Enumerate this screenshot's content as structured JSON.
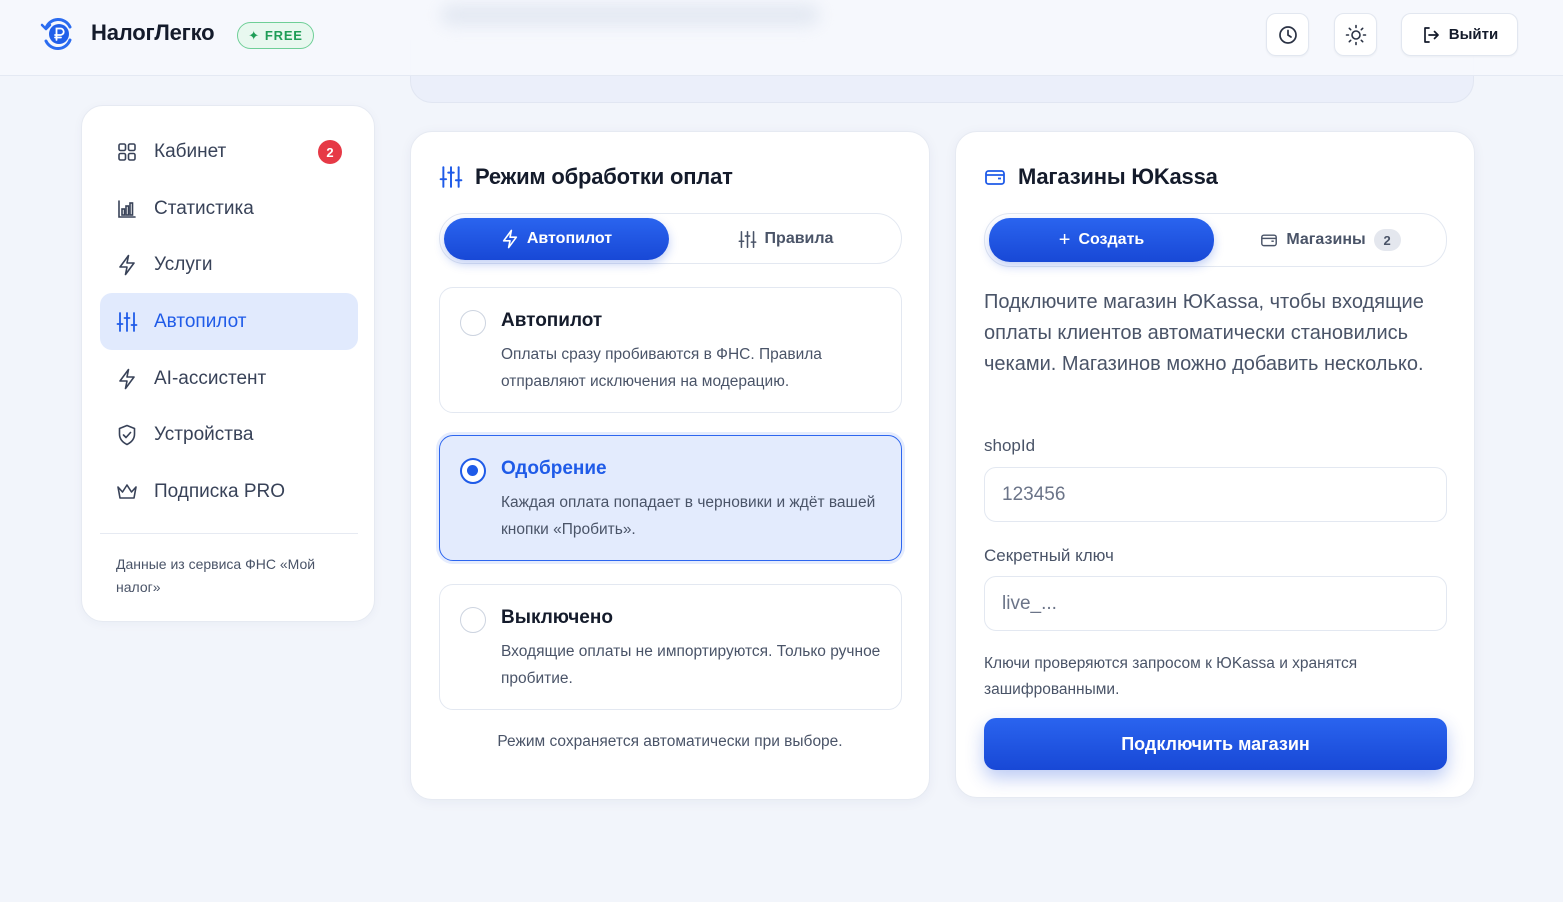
{
  "header": {
    "brand": "НалогЛегко",
    "plan_badge": "FREE",
    "logout_label": "Выйти"
  },
  "sidebar": {
    "items": [
      {
        "label": "Кабинет",
        "icon": "grid-icon",
        "badge": "2"
      },
      {
        "label": "Статистика",
        "icon": "bar-chart-icon"
      },
      {
        "label": "Услуги",
        "icon": "lightning-icon"
      },
      {
        "label": "Автопилот",
        "icon": "sliders-icon",
        "active": true
      },
      {
        "label": "AI-ассистент",
        "icon": "lightning-icon"
      },
      {
        "label": "Устройства",
        "icon": "shield-icon"
      },
      {
        "label": "Подписка PRO",
        "icon": "crown-icon"
      }
    ],
    "footer": "Данные из сервиса ФНС «Мой налог»"
  },
  "mode_card": {
    "title": "Режим обработки оплат",
    "tabs": [
      {
        "label": "Автопилот",
        "active": true
      },
      {
        "label": "Правила",
        "active": false
      }
    ],
    "options": [
      {
        "title": "Автопилот",
        "description": "Оплаты сразу пробиваются в ФНС. Правила отправляют исключения на модерацию.",
        "selected": false
      },
      {
        "title": "Одобрение",
        "description": "Каждая оплата попадает в черновики и ждёт вашей кнопки «Пробить».",
        "selected": true
      },
      {
        "title": "Выключено",
        "description": "Входящие оплаты не импортируются. Только ручное пробитие.",
        "selected": false
      }
    ],
    "note": "Режим сохраняется автоматически при выборе."
  },
  "shops_card": {
    "title": "Магазины ЮKassa",
    "tabs": [
      {
        "label": "Создать",
        "active": true
      },
      {
        "label": "Магазины",
        "count": "2",
        "active": false
      }
    ],
    "intro": "Подключите магазин ЮKassa, чтобы входящие оплаты клиентов автоматически становились чеками. Магазинов можно добавить несколько.",
    "shop_id_label": "shopId",
    "shop_id_placeholder": "123456",
    "secret_label": "Секретный ключ",
    "secret_placeholder": "live_...",
    "keys_note": "Ключи проверяются запросом к ЮKassa и хранятся зашифрованными.",
    "connect_label": "Подключить магазин"
  },
  "colors": {
    "accent": "#1f5be8",
    "badge_red": "#e63946",
    "free_green": "#1f9d57"
  }
}
